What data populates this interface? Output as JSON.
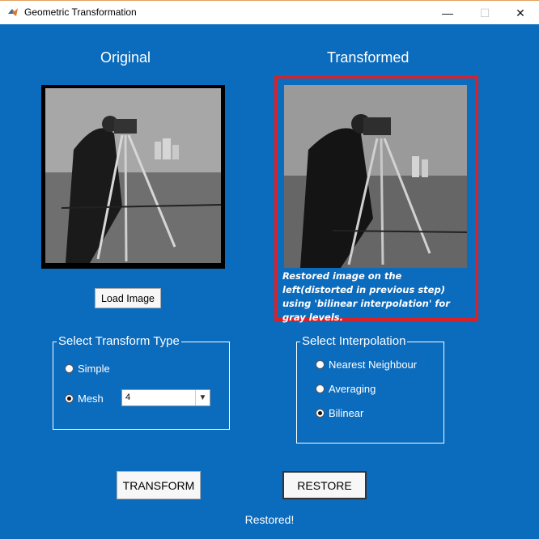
{
  "window": {
    "title": "Geometric Transformation",
    "icon": "matlab-icon",
    "minimize_glyph": "—",
    "maximize_glyph": "☐",
    "close_glyph": "✕"
  },
  "headings": {
    "original": "Original",
    "transformed": "Transformed"
  },
  "overlay_note": "Restored image on the left(distorted in previous step) using 'bilinear interpolation' for gray levels.",
  "buttons": {
    "load": "Load Image",
    "transform": "TRANSFORM",
    "restore": "RESTORE"
  },
  "transform_type": {
    "title": "Select Transform Type",
    "options": [
      {
        "label": "Simple",
        "selected": false
      },
      {
        "label": "Mesh",
        "selected": true
      }
    ],
    "mesh_value": "4"
  },
  "interpolation": {
    "title": "Select Interpolation",
    "options": [
      {
        "label": "Nearest Neighbour",
        "selected": false
      },
      {
        "label": "Averaging",
        "selected": false
      },
      {
        "label": "Bilinear",
        "selected": true
      }
    ]
  },
  "status": "Restored!",
  "colors": {
    "background": "#0b6bbd",
    "highlight_border": "#d8222a"
  }
}
